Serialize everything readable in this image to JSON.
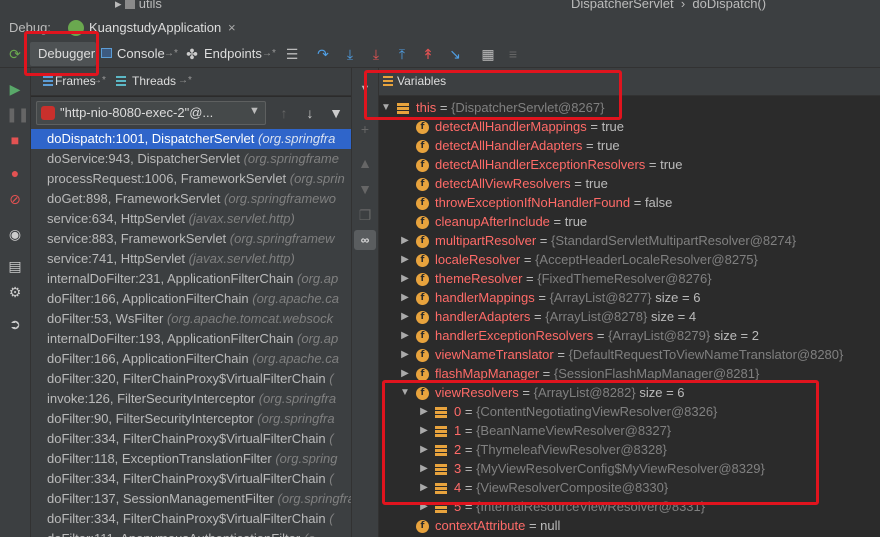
{
  "top": {
    "tree_item": "utils",
    "breadcrumb": [
      "DispatcherServlet",
      "doDispatch()"
    ]
  },
  "debug_bar": {
    "label": "Debug:",
    "app_name": "KuangstudyApplication"
  },
  "toolbar": {
    "debugger_tab": "Debugger",
    "console_tab": "Console",
    "endpoints_tab": "Endpoints",
    "pin_marker": "→*"
  },
  "frames_panel": {
    "frames_tab": "Frames",
    "threads_tab": "Threads",
    "pin_marker": "→*",
    "thread_value": "\"http-nio-8080-exec-2\"@..."
  },
  "frames": [
    {
      "method": "doDispatch:1001, DispatcherServlet",
      "pkg": "(org.springfra"
    },
    {
      "method": "doService:943, DispatcherServlet",
      "pkg": "(org.springframe"
    },
    {
      "method": "processRequest:1006, FrameworkServlet",
      "pkg": "(org.sprin"
    },
    {
      "method": "doGet:898, FrameworkServlet",
      "pkg": "(org.springframewo"
    },
    {
      "method": "service:634, HttpServlet",
      "pkg": "(javax.servlet.http)"
    },
    {
      "method": "service:883, FrameworkServlet",
      "pkg": "(org.springframew"
    },
    {
      "method": "service:741, HttpServlet",
      "pkg": "(javax.servlet.http)"
    },
    {
      "method": "internalDoFilter:231, ApplicationFilterChain",
      "pkg": "(org.ap"
    },
    {
      "method": "doFilter:166, ApplicationFilterChain",
      "pkg": "(org.apache.ca"
    },
    {
      "method": "doFilter:53, WsFilter",
      "pkg": "(org.apache.tomcat.websock"
    },
    {
      "method": "internalDoFilter:193, ApplicationFilterChain",
      "pkg": "(org.ap"
    },
    {
      "method": "doFilter:166, ApplicationFilterChain",
      "pkg": "(org.apache.ca"
    },
    {
      "method": "doFilter:320, FilterChainProxy$VirtualFilterChain",
      "pkg": "("
    },
    {
      "method": "invoke:126, FilterSecurityInterceptor",
      "pkg": "(org.springfra"
    },
    {
      "method": "doFilter:90, FilterSecurityInterceptor",
      "pkg": "(org.springfra"
    },
    {
      "method": "doFilter:334, FilterChainProxy$VirtualFilterChain",
      "pkg": "("
    },
    {
      "method": "doFilter:118, ExceptionTranslationFilter",
      "pkg": "(org.spring"
    },
    {
      "method": "doFilter:334, FilterChainProxy$VirtualFilterChain",
      "pkg": "("
    },
    {
      "method": "doFilter:137, SessionManagementFilter",
      "pkg": "(org.springfra"
    },
    {
      "method": "doFilter:334, FilterChainProxy$VirtualFilterChain",
      "pkg": "("
    },
    {
      "method": "doFilter:111, AnonymousAuthenticationFilter",
      "pkg": "(o"
    }
  ],
  "variables_panel": {
    "title": "Variables"
  },
  "variables": {
    "this": {
      "name": "this",
      "value": "{DispatcherServlet@8267}"
    },
    "fields": [
      {
        "name": "detectAllHandlerMappings",
        "value": "true"
      },
      {
        "name": "detectAllHandlerAdapters",
        "value": "true"
      },
      {
        "name": "detectAllHandlerExceptionResolvers",
        "value": "true"
      },
      {
        "name": "detectAllViewResolvers",
        "value": "true"
      },
      {
        "name": "throwExceptionIfNoHandlerFound",
        "value": "false"
      },
      {
        "name": "cleanupAfterInclude",
        "value": "true"
      },
      {
        "name": "multipartResolver",
        "ref": "{StandardServletMultipartResolver@8274}"
      },
      {
        "name": "localeResolver",
        "ref": "{AcceptHeaderLocaleResolver@8275}"
      },
      {
        "name": "themeResolver",
        "ref": "{FixedThemeResolver@8276}"
      },
      {
        "name": "handlerMappings",
        "ref": "{ArrayList@8277}",
        "extra": "size = 6"
      },
      {
        "name": "handlerAdapters",
        "ref": "{ArrayList@8278}",
        "extra": "size = 4"
      },
      {
        "name": "handlerExceptionResolvers",
        "ref": "{ArrayList@8279}",
        "extra": "size = 2"
      },
      {
        "name": "viewNameTranslator",
        "ref": "{DefaultRequestToViewNameTranslator@8280}"
      },
      {
        "name": "flashMapManager",
        "ref": "{SessionFlashMapManager@8281}"
      },
      {
        "name": "viewResolvers",
        "ref": "{ArrayList@8282}",
        "extra": "size = 6"
      }
    ],
    "view_resolvers": [
      {
        "index": "0",
        "ref": "{ContentNegotiatingViewResolver@8326}"
      },
      {
        "index": "1",
        "ref": "{BeanNameViewResolver@8327}"
      },
      {
        "index": "2",
        "ref": "{ThymeleafViewResolver@8328}"
      },
      {
        "index": "3",
        "ref": "{MyViewResolverConfig$MyViewResolver@8329}"
      },
      {
        "index": "4",
        "ref": "{ViewResolverComposite@8330}"
      },
      {
        "index": "5",
        "ref": "{InternalResourceViewResolver@8331}"
      }
    ],
    "last": {
      "name": "contextAttribute",
      "value": "null"
    }
  },
  "colors": {
    "highlight": "#e0141e",
    "selection": "#2f65ca",
    "field_name": "#ff6b68",
    "icon": "#e8a33d"
  }
}
